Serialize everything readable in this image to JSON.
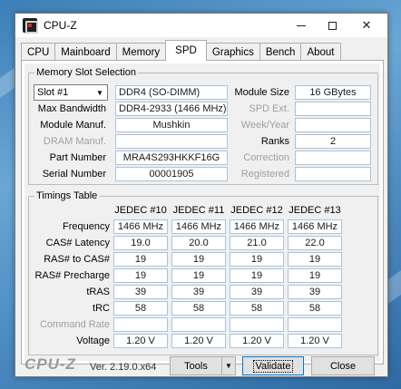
{
  "window": {
    "title": "CPU-Z"
  },
  "tabs": [
    {
      "label": "CPU"
    },
    {
      "label": "Mainboard"
    },
    {
      "label": "Memory"
    },
    {
      "label": "SPD",
      "active": true
    },
    {
      "label": "Graphics"
    },
    {
      "label": "Bench"
    },
    {
      "label": "About"
    }
  ],
  "memory_slot": {
    "legend": "Memory Slot Selection",
    "slot_selected": "Slot #1",
    "type": "DDR4 (SO-DIMM)",
    "max_bandwidth_label": "Max Bandwidth",
    "max_bandwidth": "DDR4-2933 (1466 MHz)",
    "module_manuf_label": "Module Manuf.",
    "module_manuf": "Mushkin",
    "dram_manuf_label": "DRAM Manuf.",
    "dram_manuf": "",
    "part_number_label": "Part Number",
    "part_number": "MRA4S293HKKF16G",
    "serial_number_label": "Serial Number",
    "serial_number": "00001905",
    "module_size_label": "Module Size",
    "module_size": "16 GBytes",
    "spd_ext_label": "SPD Ext.",
    "spd_ext": "",
    "week_year_label": "Week/Year",
    "week_year": "",
    "ranks_label": "Ranks",
    "ranks": "2",
    "correction_label": "Correction",
    "correction": "",
    "registered_label": "Registered",
    "registered": ""
  },
  "timings": {
    "legend": "Timings Table",
    "columns": [
      "JEDEC #10",
      "JEDEC #11",
      "JEDEC #12",
      "JEDEC #13"
    ],
    "rows": [
      {
        "label": "Frequency",
        "values": [
          "1466 MHz",
          "1466 MHz",
          "1466 MHz",
          "1466 MHz"
        ]
      },
      {
        "label": "CAS# Latency",
        "values": [
          "19.0",
          "20.0",
          "21.0",
          "22.0"
        ]
      },
      {
        "label": "RAS# to CAS#",
        "values": [
          "19",
          "19",
          "19",
          "19"
        ]
      },
      {
        "label": "RAS# Precharge",
        "values": [
          "19",
          "19",
          "19",
          "19"
        ]
      },
      {
        "label": "tRAS",
        "values": [
          "39",
          "39",
          "39",
          "39"
        ]
      },
      {
        "label": "tRC",
        "values": [
          "58",
          "58",
          "58",
          "58"
        ]
      },
      {
        "label": "Command Rate",
        "values": [
          "",
          "",
          "",
          ""
        ],
        "disabled": true
      },
      {
        "label": "Voltage",
        "values": [
          "1.20 V",
          "1.20 V",
          "1.20 V",
          "1.20 V"
        ]
      }
    ]
  },
  "footer": {
    "brand": "CPU-Z",
    "version": "Ver. 2.19.0.x64",
    "tools_label": "Tools",
    "validate_label": "Validate",
    "close_label": "Close"
  }
}
